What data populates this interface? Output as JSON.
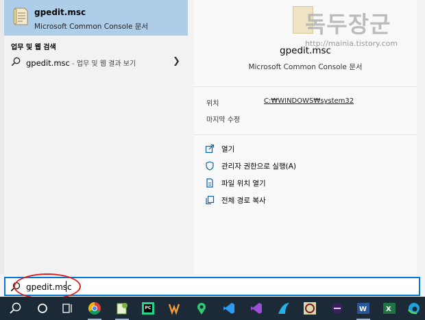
{
  "best_match": {
    "title": "gpedit.msc",
    "subtitle": "Microsoft Common Console 문서"
  },
  "web_section": {
    "heading": "업무 및 웹 검색",
    "query": "gpedit.msc",
    "suffix": " - 업무 및 웹 결과 보기"
  },
  "detail": {
    "title": "gpedit.msc",
    "subtitle": "Microsoft Common Console 문서",
    "location_label": "위치",
    "location_value": "C:₩WINDOWS₩system32",
    "modified_label": "마지막 수정",
    "actions": [
      "열기",
      "관리자 권한으로 실행(A)",
      "파일 위치 열기",
      "전체 경로 복사"
    ]
  },
  "search": {
    "value": "gpedit.msc"
  },
  "watermark": {
    "text": "독두장군",
    "url": "http://mainia.tistory.com"
  },
  "taskbar": {
    "icons": [
      "search-icon",
      "cortana-icon",
      "task-view-icon",
      "chrome-icon",
      "notepadpp-icon",
      "pycharm-icon",
      "winamp-icon",
      "maps-icon",
      "vscode-icon",
      "visual-studio-icon",
      "navigator-icon",
      "filezilla-icon",
      "terminal-icon",
      "word-icon",
      "excel-icon",
      "edge-icon"
    ]
  },
  "colors": {
    "accent": "#0078d7",
    "selection": "#aecde9",
    "highlight_circle": "#e0201c",
    "taskbar": "#1c2a38"
  }
}
